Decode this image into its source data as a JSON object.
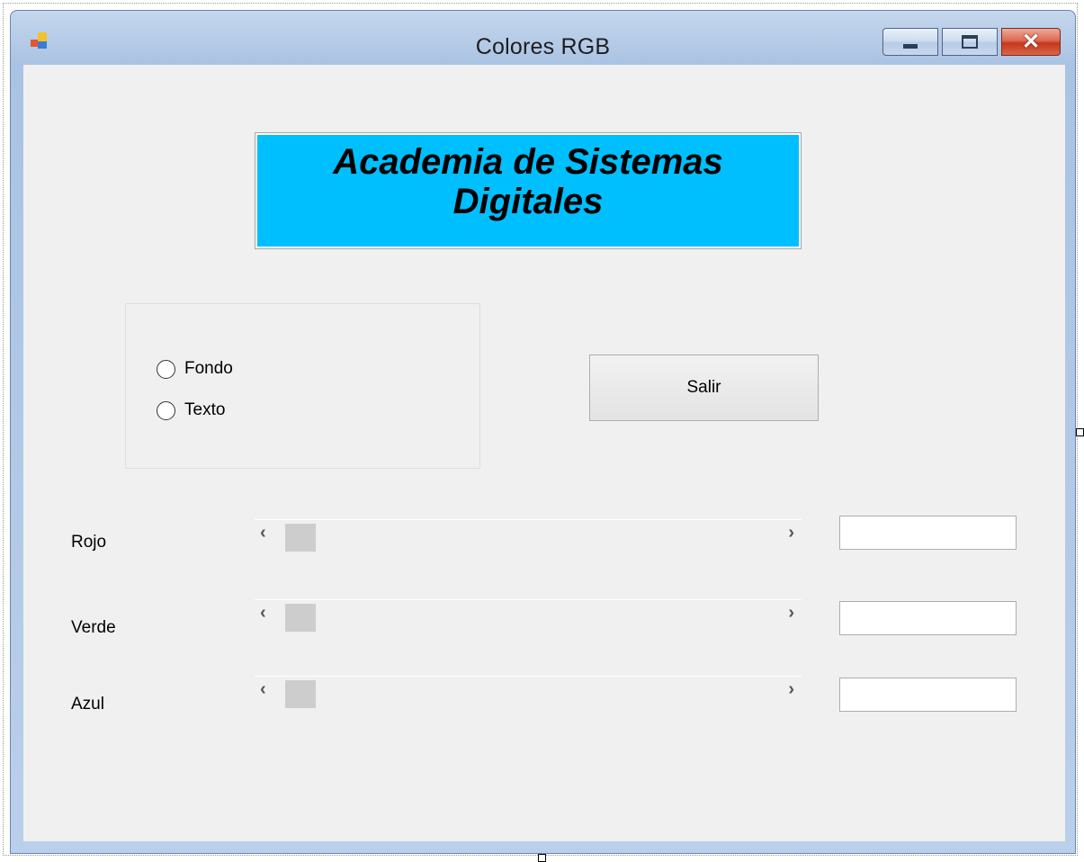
{
  "window": {
    "title": "Colores RGB",
    "close_symbol": "✕"
  },
  "banner": {
    "line1": "Academia de Sistemas",
    "line2": "Digitales",
    "background": "#00bfff"
  },
  "options": {
    "items": [
      {
        "label": "Fondo",
        "selected": false
      },
      {
        "label": "Texto",
        "selected": false
      }
    ]
  },
  "buttons": {
    "exit_label": "Salir"
  },
  "sliders": {
    "items": [
      {
        "label": "Rojo",
        "value": 0,
        "box_value": ""
      },
      {
        "label": "Verde",
        "value": 0,
        "box_value": ""
      },
      {
        "label": "Azul",
        "value": 0,
        "box_value": ""
      }
    ],
    "left_arrow": "‹",
    "right_arrow": "›"
  },
  "icons": [
    "app-icon",
    "minimize-icon",
    "maximize-icon",
    "close-icon",
    "scroll-left-icon",
    "scroll-right-icon"
  ]
}
